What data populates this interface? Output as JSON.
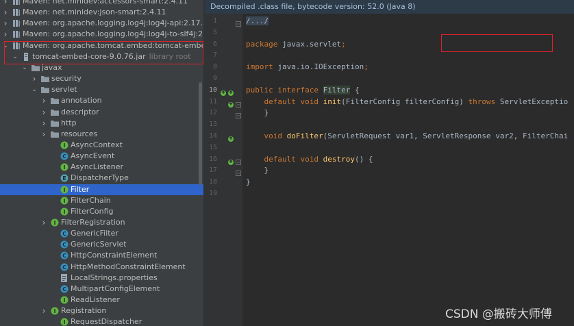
{
  "sidebar": {
    "rows": [
      {
        "label": "Maven: net.minidev:accessors-smart:2.4.11",
        "icon": "library-icon",
        "chev": "closed"
      },
      {
        "label": "Maven: net.minidev:json-smart:2.4.11",
        "icon": "library-icon",
        "chev": "closed"
      },
      {
        "label": "Maven: org.apache.logging.log4j:log4j-api:2.17.2",
        "icon": "library-icon",
        "chev": "closed"
      },
      {
        "label": "Maven: org.apache.logging.log4j:log4j-to-slf4j:2.17.2",
        "icon": "library-icon",
        "chev": "closed"
      },
      {
        "label": "Maven: org.apache.tomcat.embed:tomcat-embed-core:9.0.76",
        "icon": "library-icon",
        "chev": "open"
      },
      {
        "label": "tomcat-embed-core-9.0.76.jar",
        "hint": "library root",
        "icon": "jar-icon",
        "chev": "open"
      },
      {
        "label": "javax",
        "icon": "package-icon",
        "chev": "open"
      },
      {
        "label": "security",
        "icon": "package-icon",
        "chev": "closed"
      },
      {
        "label": "servlet",
        "icon": "package-icon",
        "chev": "open"
      },
      {
        "label": "annotation",
        "icon": "package-icon",
        "chev": "closed"
      },
      {
        "label": "descriptor",
        "icon": "package-icon",
        "chev": "closed"
      },
      {
        "label": "http",
        "icon": "package-icon",
        "chev": "closed"
      },
      {
        "label": "resources",
        "icon": "package-icon",
        "chev": "closed"
      },
      {
        "label": "AsyncContext",
        "icon": "interface-icon",
        "chev": "none"
      },
      {
        "label": "AsyncEvent",
        "icon": "class-icon",
        "chev": "none"
      },
      {
        "label": "AsyncListener",
        "icon": "interface-icon",
        "chev": "none"
      },
      {
        "label": "DispatcherType",
        "icon": "enum-icon",
        "chev": "none"
      },
      {
        "label": "Filter",
        "icon": "interface-icon",
        "chev": "none",
        "selected": true
      },
      {
        "label": "FilterChain",
        "icon": "interface-icon",
        "chev": "none"
      },
      {
        "label": "FilterConfig",
        "icon": "interface-icon",
        "chev": "none"
      },
      {
        "label": "FilterRegistration",
        "icon": "interface-icon",
        "chev": "closed"
      },
      {
        "label": "GenericFilter",
        "icon": "class-icon",
        "chev": "none"
      },
      {
        "label": "GenericServlet",
        "icon": "class-icon",
        "chev": "none"
      },
      {
        "label": "HttpConstraintElement",
        "icon": "class-icon",
        "chev": "none"
      },
      {
        "label": "HttpMethodConstraintElement",
        "icon": "class-icon",
        "chev": "none"
      },
      {
        "label": "LocalStrings.properties",
        "icon": "properties-icon",
        "chev": "none"
      },
      {
        "label": "MultipartConfigElement",
        "icon": "class-icon",
        "chev": "none"
      },
      {
        "label": "ReadListener",
        "icon": "interface-icon",
        "chev": "none"
      },
      {
        "label": "Registration",
        "icon": "interface-icon",
        "chev": "closed"
      },
      {
        "label": "RequestDispatcher",
        "icon": "interface-icon",
        "chev": "none"
      }
    ]
  },
  "editor": {
    "banner": "Decompiled .class file, bytecode version: 52.0 (Java 8)",
    "lines": [
      {
        "n": "1",
        "parts": [
          {
            "t": "/.../",
            "c": "fold-box"
          }
        ]
      },
      {
        "n": "5",
        "parts": []
      },
      {
        "n": "6",
        "parts": [
          {
            "t": "package",
            "c": "kw"
          },
          {
            "t": " javax.servlet"
          },
          {
            "t": ";",
            "c": "kw"
          }
        ]
      },
      {
        "n": "7",
        "parts": []
      },
      {
        "n": "8",
        "parts": [
          {
            "t": "import",
            "c": "kw"
          },
          {
            "t": " java.io.IOException"
          },
          {
            "t": ";",
            "c": "kw"
          }
        ]
      },
      {
        "n": "9",
        "parts": []
      },
      {
        "n": "10",
        "current": true,
        "parts": [
          {
            "t": "public interface",
            "c": "kw"
          },
          {
            "t": " "
          },
          {
            "t": "Filter",
            "c": "iface"
          },
          {
            "t": " {"
          }
        ]
      },
      {
        "n": "11",
        "parts": [
          {
            "t": "    "
          },
          {
            "t": "default void",
            "c": "kw"
          },
          {
            "t": " "
          },
          {
            "t": "init",
            "c": "fn"
          },
          {
            "t": "(FilterConfig filterConfig) "
          },
          {
            "t": "throws",
            "c": "kw"
          },
          {
            "t": " ServletException {"
          }
        ]
      },
      {
        "n": "12",
        "parts": [
          {
            "t": "    }"
          }
        ]
      },
      {
        "n": "13",
        "parts": []
      },
      {
        "n": "14",
        "parts": [
          {
            "t": "    "
          },
          {
            "t": "void",
            "c": "kw"
          },
          {
            "t": " "
          },
          {
            "t": "doFilter",
            "c": "fn"
          },
          {
            "t": "(ServletRequest var1, ServletResponse var2, FilterChain var3) "
          },
          {
            "t": "throws",
            "c": "kw"
          },
          {
            "t": " IOException, ServletException;"
          }
        ]
      },
      {
        "n": "15",
        "parts": []
      },
      {
        "n": "16",
        "parts": [
          {
            "t": "    "
          },
          {
            "t": "default void",
            "c": "kw"
          },
          {
            "t": " "
          },
          {
            "t": "destroy",
            "c": "fn"
          },
          {
            "t": "() {"
          }
        ]
      },
      {
        "n": "17",
        "parts": [
          {
            "t": "    }"
          }
        ]
      },
      {
        "n": "18",
        "parts": [
          {
            "t": "}"
          }
        ]
      },
      {
        "n": "19",
        "parts": []
      }
    ]
  },
  "watermark": "CSDN @搬砖大师傅",
  "colors": {
    "accent_selection": "#2f65ca",
    "annotation_box": "#e0202c",
    "keyword": "#cc7832",
    "method": "#ffc66d"
  }
}
